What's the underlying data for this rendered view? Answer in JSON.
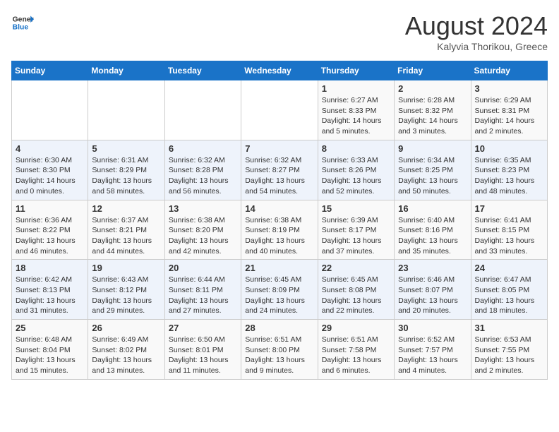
{
  "header": {
    "logo_line1": "General",
    "logo_line2": "Blue",
    "month": "August 2024",
    "location": "Kalyvia Thorikou, Greece"
  },
  "weekdays": [
    "Sunday",
    "Monday",
    "Tuesday",
    "Wednesday",
    "Thursday",
    "Friday",
    "Saturday"
  ],
  "weeks": [
    [
      {
        "day": "",
        "info": ""
      },
      {
        "day": "",
        "info": ""
      },
      {
        "day": "",
        "info": ""
      },
      {
        "day": "",
        "info": ""
      },
      {
        "day": "1",
        "info": "Sunrise: 6:27 AM\nSunset: 8:33 PM\nDaylight: 14 hours\nand 5 minutes."
      },
      {
        "day": "2",
        "info": "Sunrise: 6:28 AM\nSunset: 8:32 PM\nDaylight: 14 hours\nand 3 minutes."
      },
      {
        "day": "3",
        "info": "Sunrise: 6:29 AM\nSunset: 8:31 PM\nDaylight: 14 hours\nand 2 minutes."
      }
    ],
    [
      {
        "day": "4",
        "info": "Sunrise: 6:30 AM\nSunset: 8:30 PM\nDaylight: 14 hours\nand 0 minutes."
      },
      {
        "day": "5",
        "info": "Sunrise: 6:31 AM\nSunset: 8:29 PM\nDaylight: 13 hours\nand 58 minutes."
      },
      {
        "day": "6",
        "info": "Sunrise: 6:32 AM\nSunset: 8:28 PM\nDaylight: 13 hours\nand 56 minutes."
      },
      {
        "day": "7",
        "info": "Sunrise: 6:32 AM\nSunset: 8:27 PM\nDaylight: 13 hours\nand 54 minutes."
      },
      {
        "day": "8",
        "info": "Sunrise: 6:33 AM\nSunset: 8:26 PM\nDaylight: 13 hours\nand 52 minutes."
      },
      {
        "day": "9",
        "info": "Sunrise: 6:34 AM\nSunset: 8:25 PM\nDaylight: 13 hours\nand 50 minutes."
      },
      {
        "day": "10",
        "info": "Sunrise: 6:35 AM\nSunset: 8:23 PM\nDaylight: 13 hours\nand 48 minutes."
      }
    ],
    [
      {
        "day": "11",
        "info": "Sunrise: 6:36 AM\nSunset: 8:22 PM\nDaylight: 13 hours\nand 46 minutes."
      },
      {
        "day": "12",
        "info": "Sunrise: 6:37 AM\nSunset: 8:21 PM\nDaylight: 13 hours\nand 44 minutes."
      },
      {
        "day": "13",
        "info": "Sunrise: 6:38 AM\nSunset: 8:20 PM\nDaylight: 13 hours\nand 42 minutes."
      },
      {
        "day": "14",
        "info": "Sunrise: 6:38 AM\nSunset: 8:19 PM\nDaylight: 13 hours\nand 40 minutes."
      },
      {
        "day": "15",
        "info": "Sunrise: 6:39 AM\nSunset: 8:17 PM\nDaylight: 13 hours\nand 37 minutes."
      },
      {
        "day": "16",
        "info": "Sunrise: 6:40 AM\nSunset: 8:16 PM\nDaylight: 13 hours\nand 35 minutes."
      },
      {
        "day": "17",
        "info": "Sunrise: 6:41 AM\nSunset: 8:15 PM\nDaylight: 13 hours\nand 33 minutes."
      }
    ],
    [
      {
        "day": "18",
        "info": "Sunrise: 6:42 AM\nSunset: 8:13 PM\nDaylight: 13 hours\nand 31 minutes."
      },
      {
        "day": "19",
        "info": "Sunrise: 6:43 AM\nSunset: 8:12 PM\nDaylight: 13 hours\nand 29 minutes."
      },
      {
        "day": "20",
        "info": "Sunrise: 6:44 AM\nSunset: 8:11 PM\nDaylight: 13 hours\nand 27 minutes."
      },
      {
        "day": "21",
        "info": "Sunrise: 6:45 AM\nSunset: 8:09 PM\nDaylight: 13 hours\nand 24 minutes."
      },
      {
        "day": "22",
        "info": "Sunrise: 6:45 AM\nSunset: 8:08 PM\nDaylight: 13 hours\nand 22 minutes."
      },
      {
        "day": "23",
        "info": "Sunrise: 6:46 AM\nSunset: 8:07 PM\nDaylight: 13 hours\nand 20 minutes."
      },
      {
        "day": "24",
        "info": "Sunrise: 6:47 AM\nSunset: 8:05 PM\nDaylight: 13 hours\nand 18 minutes."
      }
    ],
    [
      {
        "day": "25",
        "info": "Sunrise: 6:48 AM\nSunset: 8:04 PM\nDaylight: 13 hours\nand 15 minutes."
      },
      {
        "day": "26",
        "info": "Sunrise: 6:49 AM\nSunset: 8:02 PM\nDaylight: 13 hours\nand 13 minutes."
      },
      {
        "day": "27",
        "info": "Sunrise: 6:50 AM\nSunset: 8:01 PM\nDaylight: 13 hours\nand 11 minutes."
      },
      {
        "day": "28",
        "info": "Sunrise: 6:51 AM\nSunset: 8:00 PM\nDaylight: 13 hours\nand 9 minutes."
      },
      {
        "day": "29",
        "info": "Sunrise: 6:51 AM\nSunset: 7:58 PM\nDaylight: 13 hours\nand 6 minutes."
      },
      {
        "day": "30",
        "info": "Sunrise: 6:52 AM\nSunset: 7:57 PM\nDaylight: 13 hours\nand 4 minutes."
      },
      {
        "day": "31",
        "info": "Sunrise: 6:53 AM\nSunset: 7:55 PM\nDaylight: 13 hours\nand 2 minutes."
      }
    ]
  ]
}
